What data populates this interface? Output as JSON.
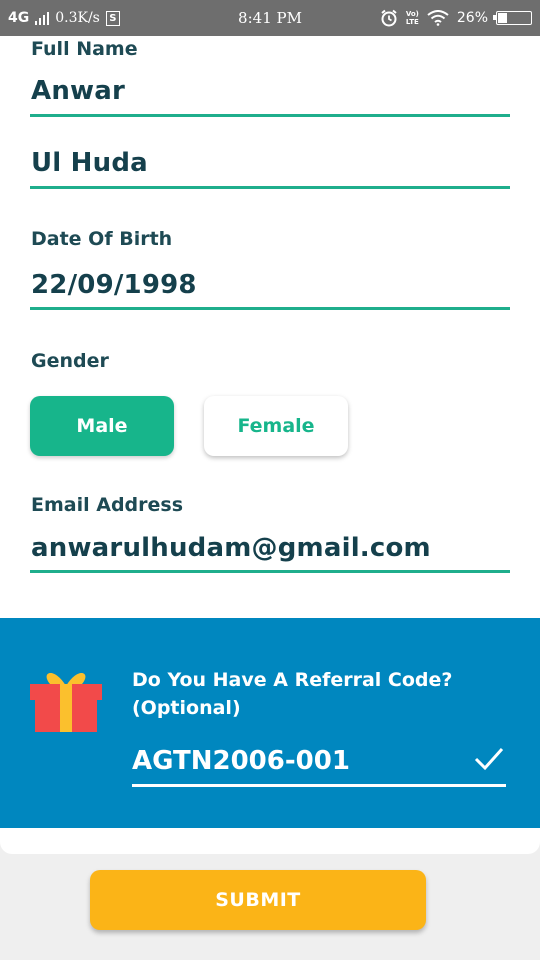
{
  "status_bar": {
    "network": "4G",
    "speed": "0.3K/s",
    "time": "8:41 PM",
    "volte_top": "Vo)",
    "volte_bottom": "LTE",
    "battery": "26%"
  },
  "form": {
    "full_name_label": "Full Name",
    "first_name": "Anwar",
    "last_name": "Ul Huda",
    "dob_label": "Date Of Birth",
    "dob_value": "22/09/1998",
    "gender_label": "Gender",
    "gender_options": [
      "Male",
      "Female"
    ],
    "gender_selected": "Male",
    "email_label": "Email Address",
    "email_value": "anwarulhudam@gmail.com"
  },
  "referral": {
    "title": "Do You Have A Referral Code? (Optional)",
    "code": "AGTN2006-001"
  },
  "submit_label": "SUBMIT",
  "colors": {
    "accent_green": "#17b58b",
    "referral_blue": "#0087bf",
    "submit_yellow": "#fbb417",
    "text_dark": "#15404c"
  }
}
